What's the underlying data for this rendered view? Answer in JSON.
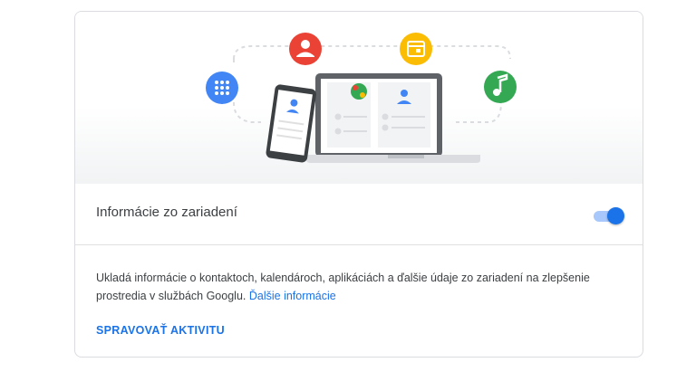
{
  "setting": {
    "title": "Informácie zo zariadení",
    "enabled": true
  },
  "description": {
    "text": "Ukladá informácie o kontaktoch, kalendároch, aplikáciách a ďalšie údaje zo zariadení na zlepšenie prostredia v službách Googlu.",
    "link": "Ďalšie informácie"
  },
  "actions": {
    "manage_activity": "SPRAVOVAŤ AKTIVITU"
  },
  "illustration": {
    "icons": [
      "apps-grid-icon",
      "contact-person-icon",
      "calendar-icon",
      "music-note-icon"
    ],
    "colors": {
      "blue": "#4285f4",
      "red": "#ea4335",
      "yellow": "#fbbc04",
      "green": "#34a853"
    }
  }
}
